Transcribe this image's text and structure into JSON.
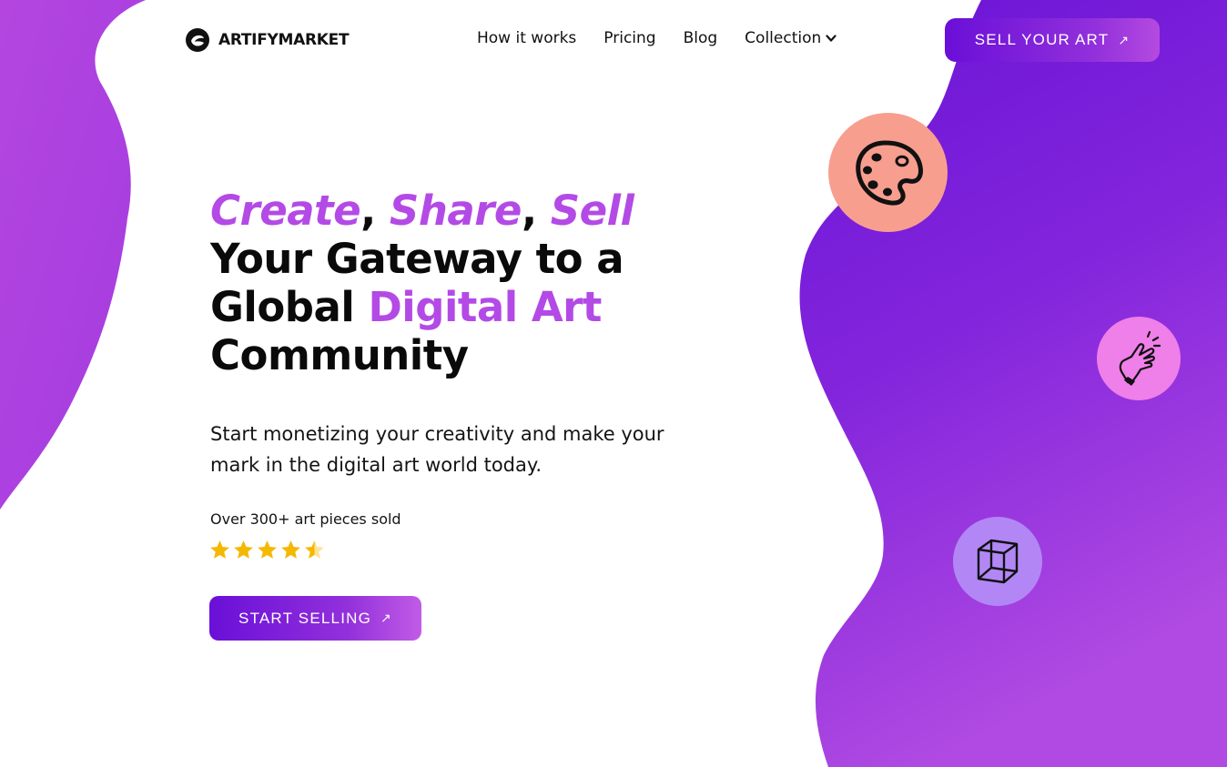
{
  "brand": {
    "name": "ARTIFYMARKET"
  },
  "nav": {
    "items": [
      {
        "label": "How it works"
      },
      {
        "label": "Pricing"
      },
      {
        "label": "Blog"
      },
      {
        "label": "Collection"
      }
    ]
  },
  "header": {
    "cta_label": "SELL YOUR ART",
    "cta_icon": "↗"
  },
  "hero": {
    "line1_word1": "Create",
    "line1_sep1": ", ",
    "line1_word2": "Share",
    "line1_sep2": ", ",
    "line1_word3": "Sell",
    "line2": "Your Gateway to a",
    "line3_plain": "Global ",
    "line3_accent": "Digital Art",
    "line4": "Community",
    "subtitle": "Start monetizing your creativity and make your mark in the digital art world today.",
    "social_proof": "Over 300+ art pieces sold",
    "rating": 4.5,
    "cta_label": "START SELLING",
    "cta_icon": "↗"
  },
  "icons": {
    "bubbles": [
      "palette-icon",
      "snapping-fingers-icon",
      "3d-cube-icon"
    ]
  },
  "colors": {
    "accent": "#b44ae6",
    "purple_dark": "#6a0fd8",
    "palette_bubble": "#f89e8f",
    "hand_bubble": "#ef7fe9",
    "cube_bubble": "#b287f5",
    "star": "#f5b800"
  }
}
